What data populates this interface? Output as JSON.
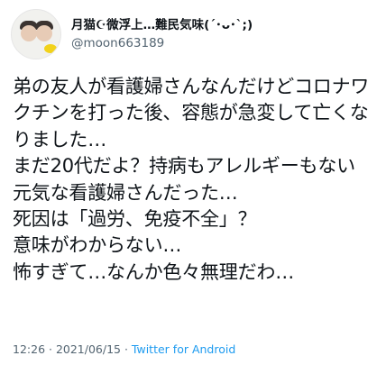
{
  "user": {
    "display_name": "月猫☪微浮上…難民気味(´･ᴗ･`;)",
    "handle": "@moon663189"
  },
  "tweet": {
    "text": "弟の友人が看護婦さんなんだけどコロナワクチンを打った後、容態が急変して亡くなりました…\nまだ20代だよ？持病もアレルギーもない元気な看護婦さんだった…\n死因は「過労、免疫不全」？\n意味がわからない…\n怖すぎて…なんか色々無理だわ…",
    "time": "12:26",
    "separator": " · ",
    "date": "2021/06/15",
    "source": "Twitter for Android"
  },
  "colors": {
    "text": "#0f1419",
    "secondary": "#536471",
    "link": "#1d9bf0"
  }
}
